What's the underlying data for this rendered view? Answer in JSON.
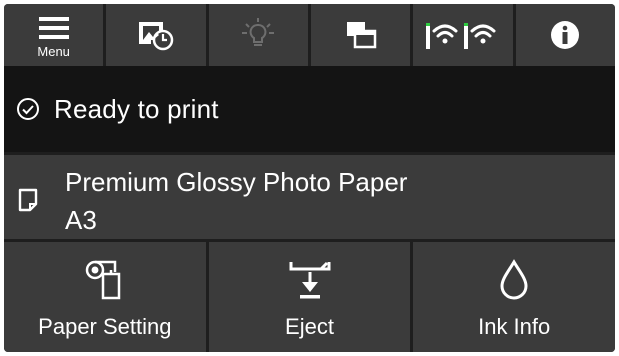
{
  "toolbar": {
    "items": [
      {
        "icon": "menu-icon",
        "label": "Menu"
      },
      {
        "icon": "image-clock-icon"
      },
      {
        "icon": "light-bulb-icon"
      },
      {
        "icon": "windows-icon"
      },
      {
        "icon": "wifi-status-icon"
      },
      {
        "icon": "info-icon"
      }
    ]
  },
  "status": {
    "text": "Ready to print",
    "icon": "check-circle-icon"
  },
  "paper": {
    "name": "Premium Glossy Photo Paper",
    "size": "A3",
    "icon": "paper-sheet-icon"
  },
  "actions": [
    {
      "label": "Paper Setting",
      "icon": "paper-setting-icon"
    },
    {
      "label": "Eject",
      "icon": "eject-icon"
    },
    {
      "label": "Ink Info",
      "icon": "ink-drop-icon"
    }
  ],
  "colors": {
    "background": "#1e1e1e",
    "button": "#3b3b3b",
    "status_bg": "#141414",
    "text": "#ffffff",
    "disabled_icon": "#6e6e6e"
  }
}
